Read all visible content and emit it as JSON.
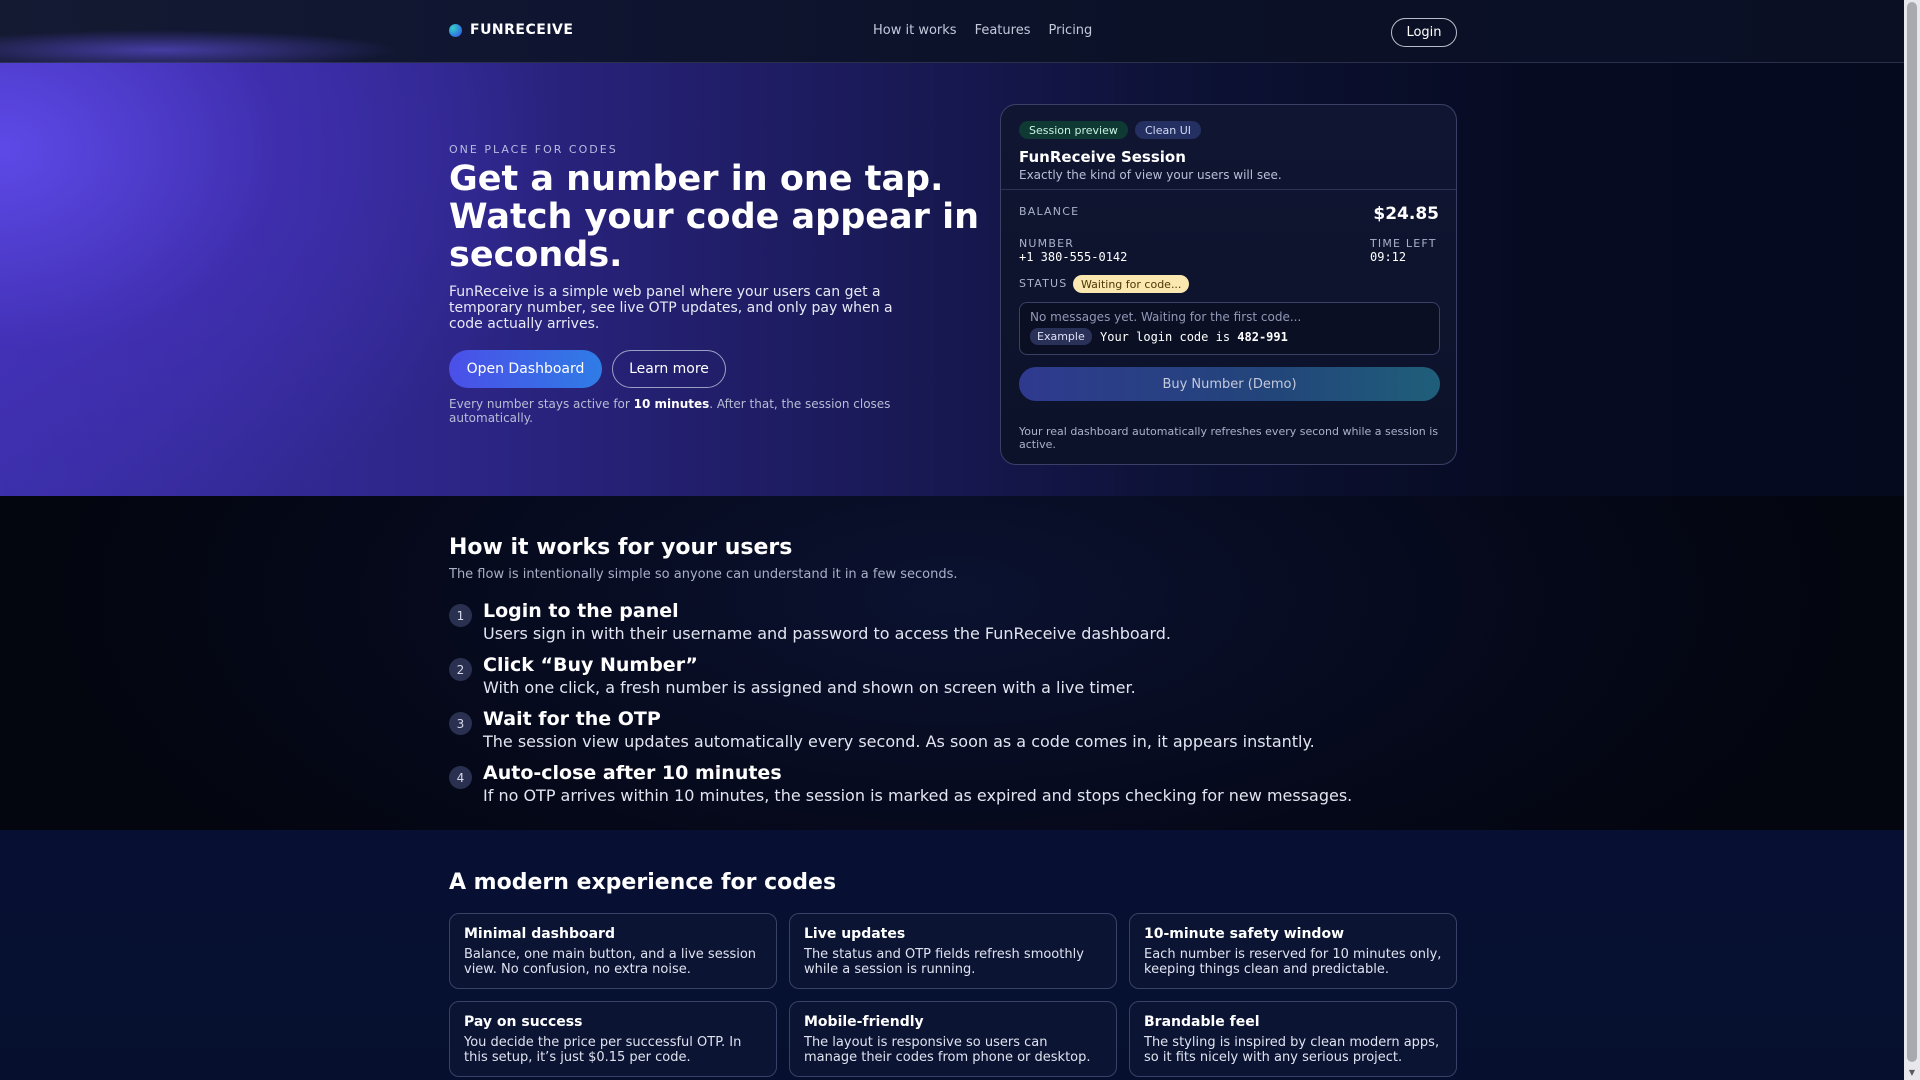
{
  "header": {
    "brand": "FUNRECEIVE",
    "nav": [
      "How it works",
      "Features",
      "Pricing"
    ],
    "login": "Login"
  },
  "hero": {
    "eyebrow": "ONE PLACE FOR CODES",
    "title": "Get a number in one tap. Watch your code appear in seconds.",
    "description": "FunReceive is a simple web panel where your users can get a temporary number, see live OTP updates, and only pay when a code actually arrives.",
    "primary_button": "Open Dashboard",
    "secondary_button": "Learn more",
    "note_before": "Every number stays active for ",
    "note_bold": "10 minutes",
    "note_after": ". After that, the session closes automatically."
  },
  "session_card": {
    "pill_1": "Session preview",
    "pill_2": "Clean UI",
    "title": "FunReceive Session",
    "subtitle": "Exactly the kind of view your users will see.",
    "balance_label": "BALANCE",
    "balance_value": "$24.85",
    "number_label": "NUMBER",
    "number_value": "+1 380-555-0142",
    "time_left_label": "TIME LEFT",
    "time_left_value": "09:12",
    "status_label": "STATUS",
    "status_value": "Waiting for code...",
    "empty_message": "No messages yet. Waiting for the first code...",
    "example_badge": "Example",
    "example_text": "Your login code is ",
    "example_code": "482-991",
    "buy_button": "Buy Number (Demo)",
    "footer_note": "Your real dashboard automatically refreshes every second while a session is active."
  },
  "how_it_works": {
    "title": "How it works for your users",
    "subtitle": "The flow is intentionally simple so anyone can understand it in a few seconds.",
    "steps": [
      {
        "num": "1",
        "title": "Login to the panel",
        "desc": "Users sign in with their username and password to access the FunReceive dashboard."
      },
      {
        "num": "2",
        "title": "Click “Buy Number”",
        "desc": "With one click, a fresh number is assigned and shown on screen with a live timer."
      },
      {
        "num": "3",
        "title": "Wait for the OTP",
        "desc": "The session view updates automatically every second. As soon as a code comes in, it appears instantly."
      },
      {
        "num": "4",
        "title": "Auto-close after 10 minutes",
        "desc": "If no OTP arrives within 10 minutes, the session is marked as expired and stops checking for new messages."
      }
    ]
  },
  "features": {
    "title": "A modern experience for codes",
    "items": [
      {
        "title": "Minimal dashboard",
        "desc": "Balance, one main button, and a live session view. No confusion, no extra noise."
      },
      {
        "title": "Live updates",
        "desc": "The status and OTP fields refresh smoothly while a session is running."
      },
      {
        "title": "10-minute safety window",
        "desc": "Each number is reserved for 10 minutes only, keeping things clean and predictable."
      },
      {
        "title": "Pay on success",
        "desc": "You decide the price per successful OTP. In this setup, it’s just $0.15 per code."
      },
      {
        "title": "Mobile-friendly",
        "desc": "The layout is responsive so users can manage their codes from phone or desktop."
      },
      {
        "title": "Brandable feel",
        "desc": "The styling is inspired by clean modern apps, so it fits nicely with any serious project."
      }
    ]
  }
}
